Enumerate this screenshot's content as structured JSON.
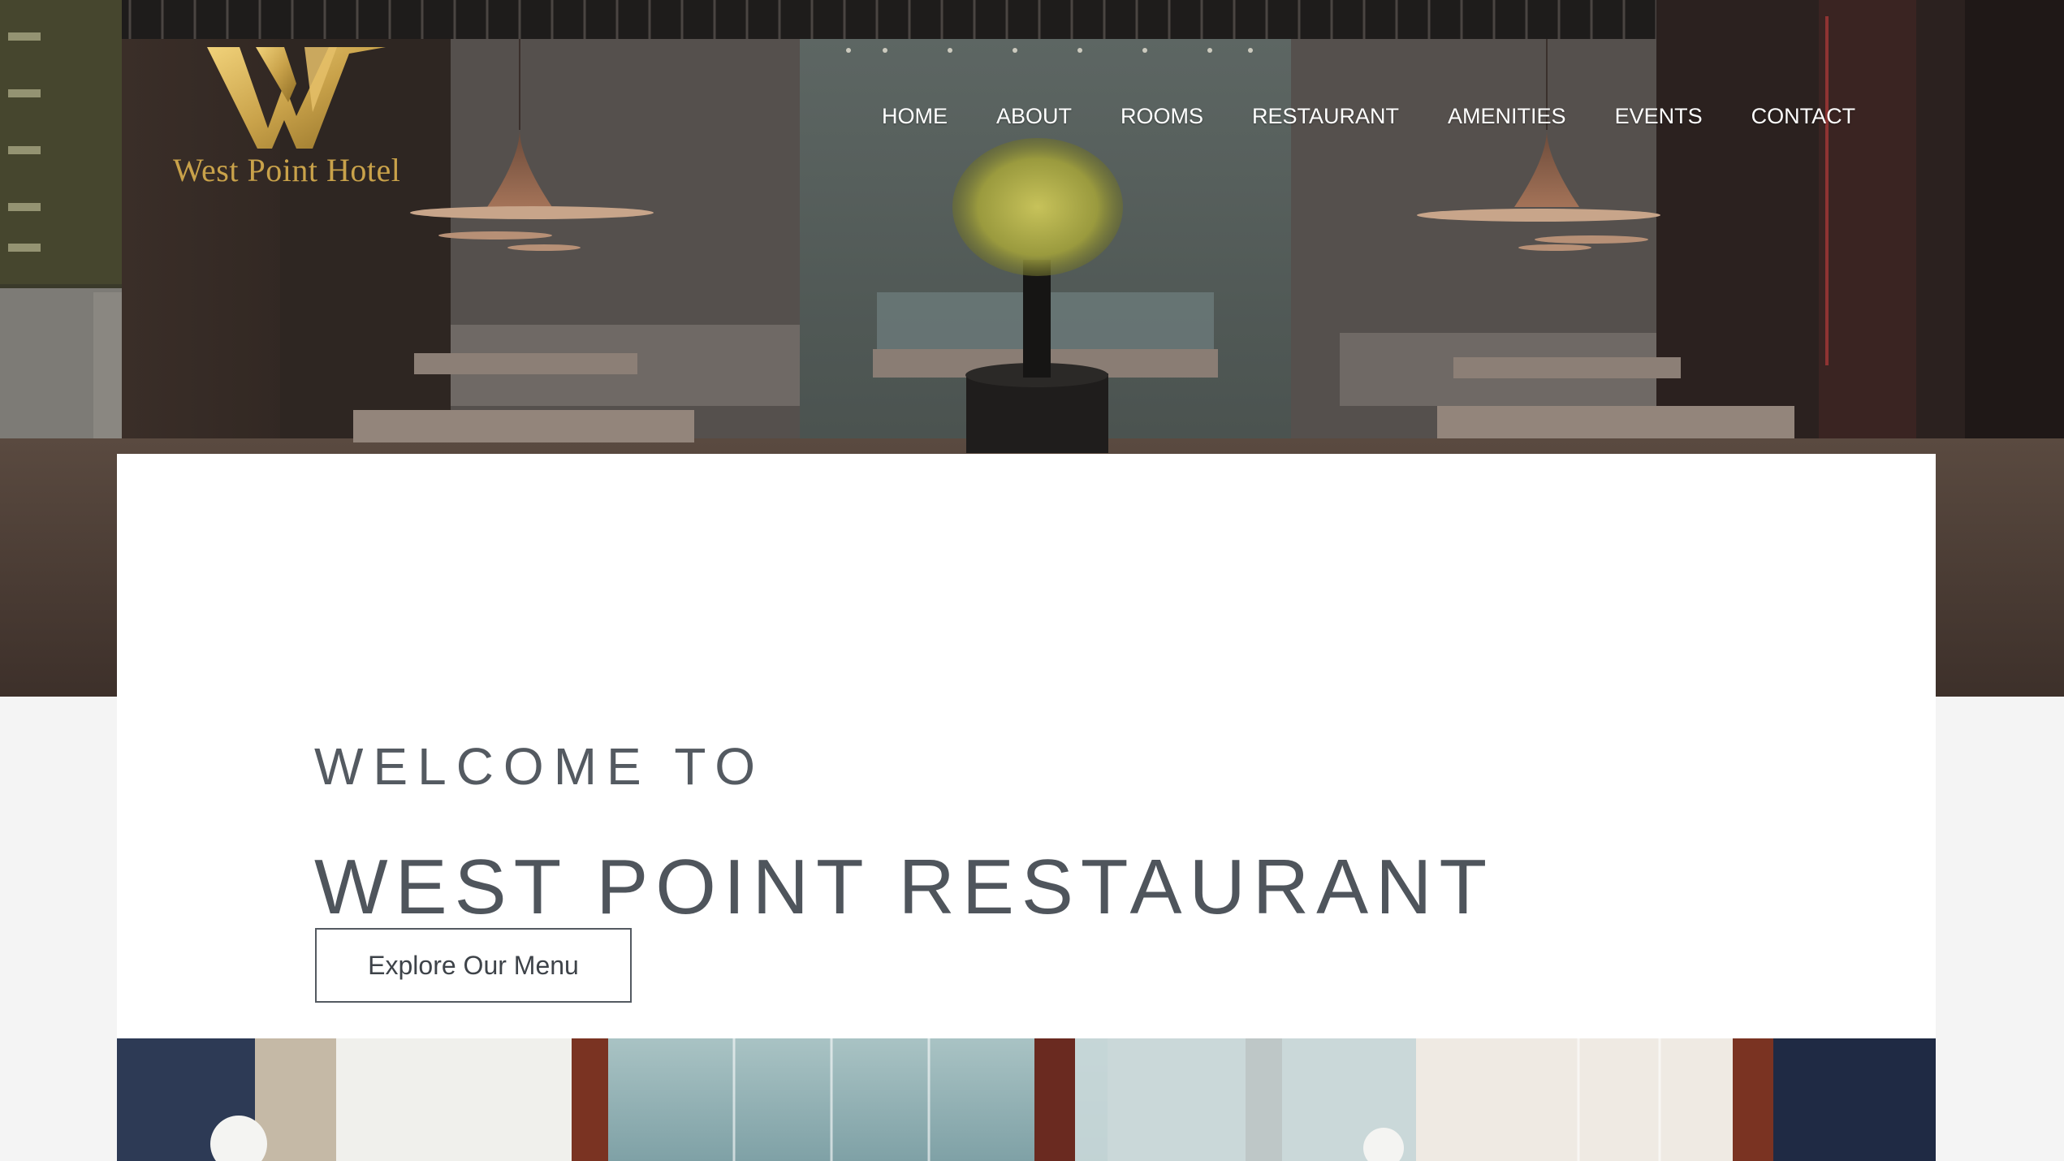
{
  "brand": {
    "name": "West Point Hotel",
    "logo_icon": "w-monogram-icon",
    "gold": "#c9a24a"
  },
  "nav": {
    "items": [
      {
        "label": "HOME"
      },
      {
        "label": "ABOUT"
      },
      {
        "label": "ROOMS"
      },
      {
        "label": "RESTAURANT"
      },
      {
        "label": "AMENITIES"
      },
      {
        "label": "EVENTS"
      },
      {
        "label": "CONTACT"
      }
    ]
  },
  "hero": {
    "image": "restaurant-dining-room-photo"
  },
  "intro": {
    "eyebrow": "WELCOME TO",
    "title": "WEST POINT RESTAURANT",
    "cta_label": "Explore Our Menu",
    "text_color": "#545a61"
  },
  "gallery": {
    "image": "restaurant-window-view-photo"
  }
}
